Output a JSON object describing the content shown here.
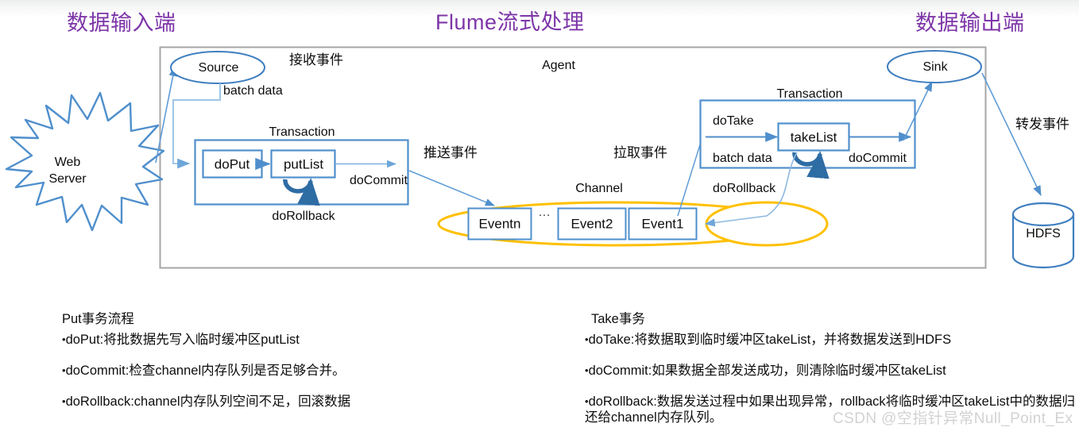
{
  "headers": {
    "left": "数据输入端",
    "middle": "Flume流式处理",
    "right": "数据输出端",
    "color": "#7d36a8"
  },
  "diagram": {
    "agent_label": "Agent",
    "source_node": "Source",
    "sink_node": "Sink",
    "web_server_line1": "Web",
    "web_server_line2": "Server",
    "hdfs_node": "HDFS",
    "receive_event_label": "接收事件",
    "batch_data_label": "batch data",
    "push_event_label": "推送事件",
    "pull_event_label": "拉取事件",
    "forward_event_label": "转发事件",
    "channel_label": "Channel",
    "put_transaction_label": "Transaction",
    "take_transaction_label": "Transaction",
    "do_put": "doPut",
    "put_list": "putList",
    "put_do_commit": "doCommit",
    "put_do_rollback": "doRollback",
    "do_take": "doTake",
    "take_list": "takeList",
    "take_batch_data": "batch data",
    "take_do_commit": "doCommit",
    "take_do_rollback": "doRollback",
    "events": [
      "Eventn",
      "Event2",
      "Event1"
    ],
    "ellipsis": "…",
    "colors": {
      "shape_blue": "#4f8fcc",
      "light_blue_line": "#7fb0dd",
      "dark_blue_arrow": "#2e6ca4",
      "channel_orange": "#ffc000",
      "agent_border": "#a6a6a6"
    }
  },
  "notes": {
    "left": {
      "title": "Put事务流程",
      "items": [
        "doPut:将批数据先写入临时缓冲区putList",
        "doCommit:检查channel内存队列是否足够合并。",
        "doRollback:channel内存队列空间不足，回滚数据"
      ]
    },
    "right": {
      "title": "Take事务",
      "items": [
        "doTake:将数据取到临时缓冲区takeList，并将数据发送到HDFS",
        "doCommit:如果数据全部发送成功，则清除临时缓冲区takeList",
        "doRollback:数据发送过程中如果出现异常，rollback将临时缓冲区takeList中的数据归还给channel内存队列。"
      ]
    },
    "bullet": "•"
  },
  "watermark": "CSDN @空指针异常Null_Point_Ex"
}
